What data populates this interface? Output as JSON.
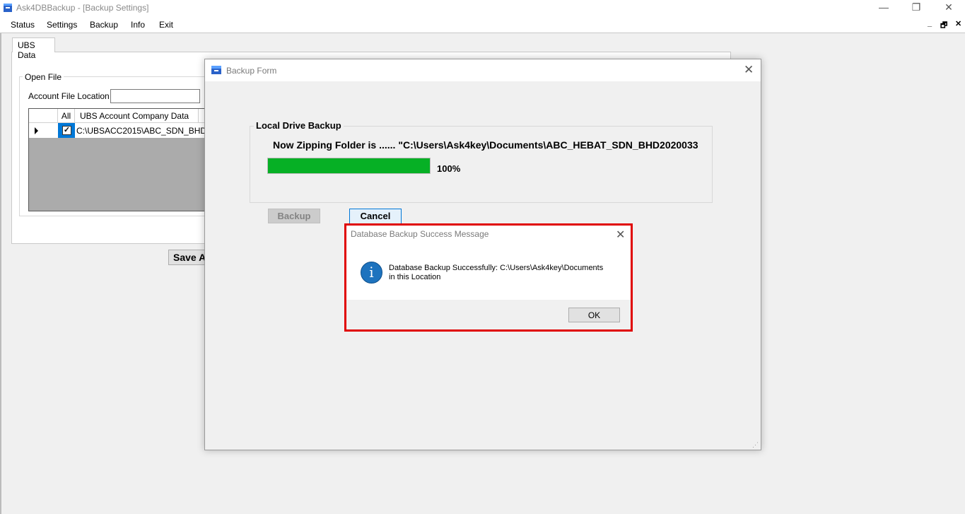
{
  "window": {
    "title": "Ask4DBBackup - [Backup Settings]",
    "controls": {
      "minimize": "—",
      "maximize": "❐",
      "close": "✕"
    }
  },
  "menu": {
    "items": [
      "Status",
      "Settings",
      "Backup",
      "Info",
      "Exit"
    ],
    "mdi_controls": {
      "minimize": "_",
      "restore": "🗗",
      "close": "✕"
    }
  },
  "settings_panel": {
    "tab_label": "UBS Data",
    "open_file_group": "Open File",
    "account_file_label": "Account File  Location",
    "location_value": "",
    "grid": {
      "headers": [
        "All",
        "UBS Account Company Data"
      ],
      "rows": [
        {
          "checked": true,
          "path": "C:\\UBSACC2015\\ABC_SDN_BHD"
        }
      ]
    },
    "save_button": "Save A"
  },
  "backup_form": {
    "title": "Backup Form",
    "group_label": "Local Drive Backup",
    "zipping_text": "Now Zipping Folder is ...... \"C:\\Users\\Ask4key\\Documents\\ABC_HEBAT_SDN_BHD2020033",
    "progress_percent": 100,
    "progress_label": "100%",
    "backup_button": "Backup",
    "cancel_button": "Cancel"
  },
  "message_box": {
    "title": "Database Backup Success Message",
    "line1": "Database Backup  Successfully: C:\\Users\\Ask4key\\Documents",
    "line2": "in this Location",
    "ok_button": "OK",
    "icon": "info-icon",
    "highlight_color": "#e00000"
  },
  "colors": {
    "progress_fill": "#06b025",
    "selection": "#0078d7",
    "info_icon": "#1e73be"
  }
}
